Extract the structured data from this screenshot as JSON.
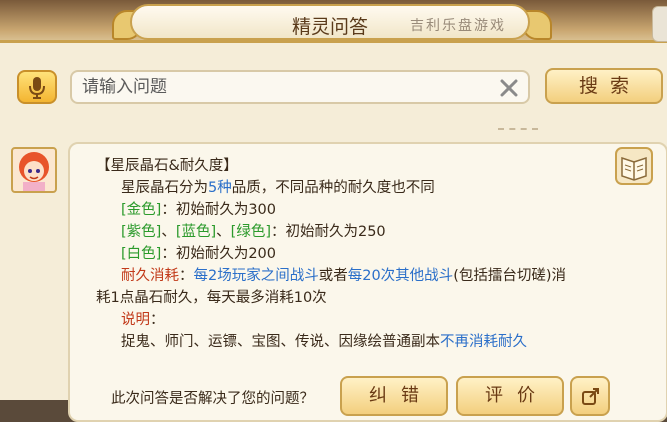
{
  "window": {
    "title": "精灵问答",
    "title_deco": "吉利乐盘游戏"
  },
  "search": {
    "placeholder": "请输入问题",
    "value": "",
    "button_label": "搜索"
  },
  "answer": {
    "heading": "【星辰晶石&耐久度】",
    "intro_prefix": "星辰晶石分为",
    "intro_number": "5种",
    "intro_suffix": "品质，不同品种的耐久度也不同",
    "gold_tag": "[金色]",
    "gold_text": "：初始耐久为300",
    "purple_tag": "[紫色]",
    "sep1": "、",
    "blue_tag": "[蓝色]",
    "sep2": "、",
    "green_tag": "[绿色]",
    "pbg_text": "：初始耐久为250",
    "white_tag": "[白色]",
    "white_text": "：初始耐久为200",
    "consume_label": "耐久消耗",
    "consume_colon": "：",
    "consume_part1": "每2场玩家之间战斗",
    "consume_or": "或者",
    "consume_part2": "每20次其他战斗",
    "consume_paren": "(包括擂台切磋)消",
    "consume_line2": "耗1点晶石耐久，每天最多消耗10次",
    "note_label": "说明",
    "note_colon": "：",
    "note_text": "捉鬼、师门、运镖、宝图、传说、因缘绘普通副本",
    "note_highlight": "不再消耗耐久"
  },
  "footer": {
    "question": "此次问答是否解决了您的问题？",
    "correct_label": "纠错",
    "rate_label": "评价"
  },
  "icons": [
    "microphone-icon",
    "clear-icon",
    "book-icon",
    "share-icon",
    "avatar"
  ],
  "colors": {
    "green": "#2b9a2b",
    "blue": "#2b6fc9",
    "red": "#c23a1a",
    "gold": "#f3cf7e"
  }
}
